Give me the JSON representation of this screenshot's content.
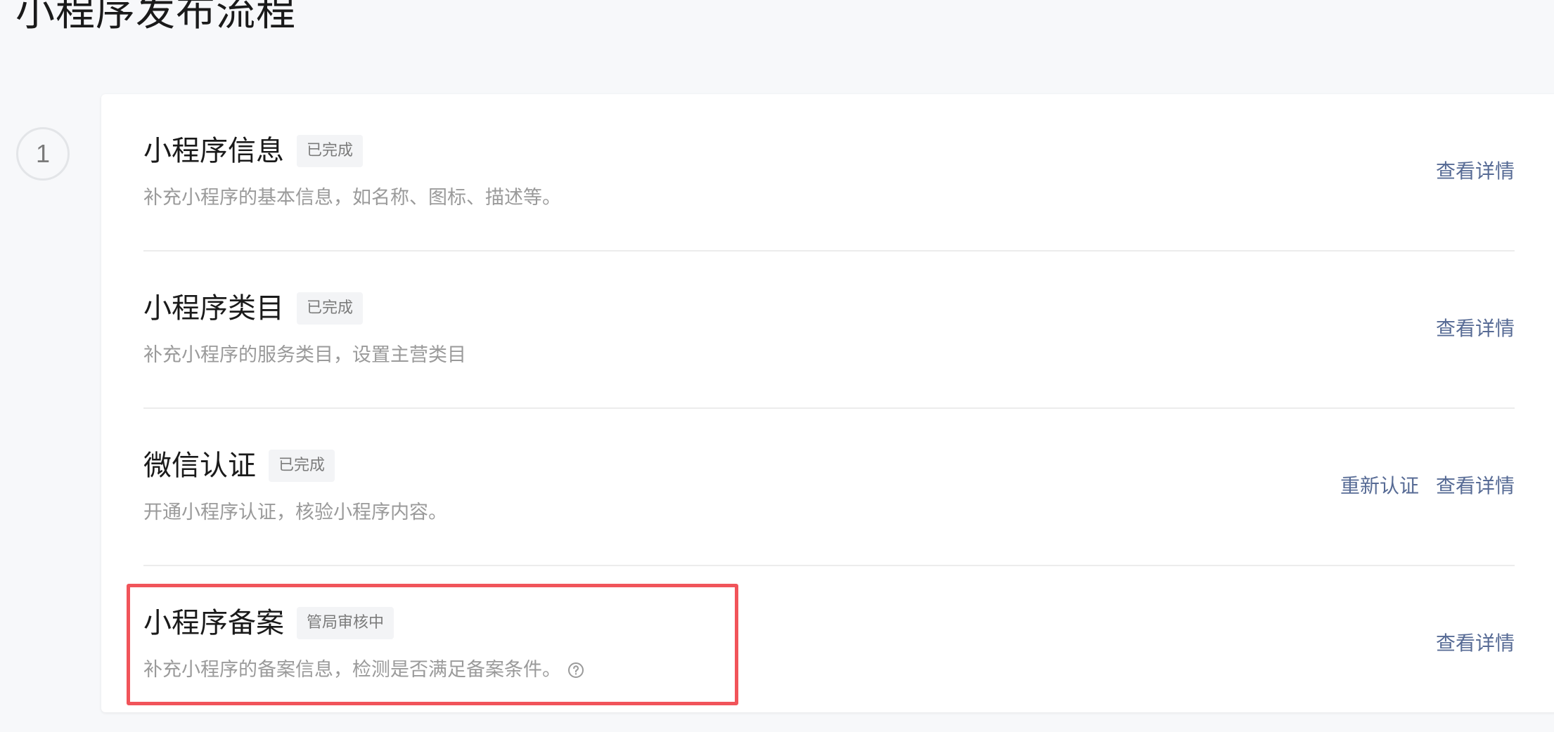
{
  "page": {
    "title": "小程序发布流程"
  },
  "step": {
    "number": "1"
  },
  "rows": [
    {
      "title": "小程序信息",
      "status": "已完成",
      "description": "补充小程序的基本信息，如名称、图标、描述等。",
      "actions": [
        "查看详情"
      ]
    },
    {
      "title": "小程序类目",
      "status": "已完成",
      "description": "补充小程序的服务类目，设置主营类目",
      "actions": [
        "查看详情"
      ]
    },
    {
      "title": "微信认证",
      "status": "已完成",
      "description": "开通小程序认证，核验小程序内容。",
      "actions": [
        "重新认证",
        "查看详情"
      ]
    },
    {
      "title": "小程序备案",
      "status": "管局审核中",
      "description": "补充小程序的备案信息，检测是否满足备案条件。",
      "actions": [
        "查看详情"
      ],
      "help_icon": "question-circle-icon",
      "highlighted": true
    }
  ],
  "colors": {
    "link": "#576b95",
    "highlight_border": "#f1545a",
    "background": "#f7f8fa"
  }
}
